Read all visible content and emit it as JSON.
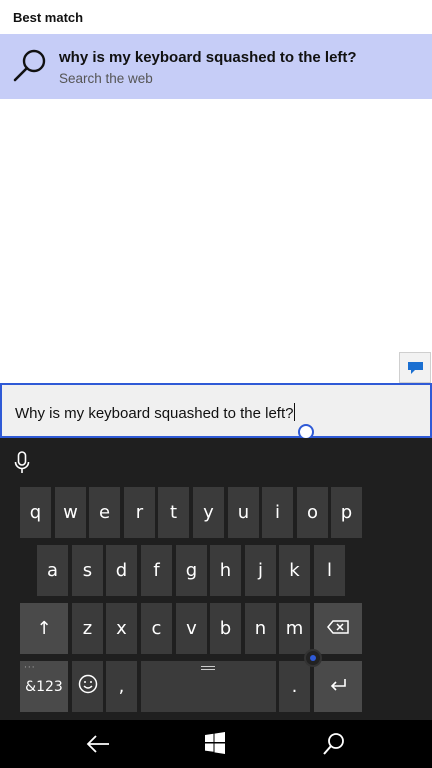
{
  "results": {
    "section_label": "Best match",
    "best_match": {
      "title": "why is my keyboard squashed to the left?",
      "subtitle": "Search the web",
      "icon": "search-icon"
    }
  },
  "feedback": {
    "icon": "feedback-icon"
  },
  "search_box": {
    "value": "Why is my keyboard squashed to the left?"
  },
  "keyboard": {
    "mic_icon": "microphone-icon",
    "row1": [
      "q",
      "w",
      "e",
      "r",
      "t",
      "y",
      "u",
      "i",
      "o",
      "p"
    ],
    "row2": [
      "a",
      "s",
      "d",
      "f",
      "g",
      "h",
      "j",
      "k",
      "l"
    ],
    "row3": [
      "z",
      "x",
      "c",
      "v",
      "b",
      "n",
      "m"
    ],
    "shift_label": "↑",
    "symbols_label": "&123",
    "emoji_icon": "emoji-icon",
    "comma_label": ",",
    "period_label": ".",
    "backspace_icon": "backspace-icon",
    "enter_icon": "enter-icon"
  },
  "navbar": {
    "back_icon": "back-arrow-icon",
    "start_icon": "windows-start-icon",
    "search_icon": "search-icon"
  },
  "colors": {
    "accent": "#2f5ad6",
    "highlight": "#c6cdf7",
    "keyboard_bg": "#1f1f1f",
    "key_bg": "#3b3b3b"
  }
}
